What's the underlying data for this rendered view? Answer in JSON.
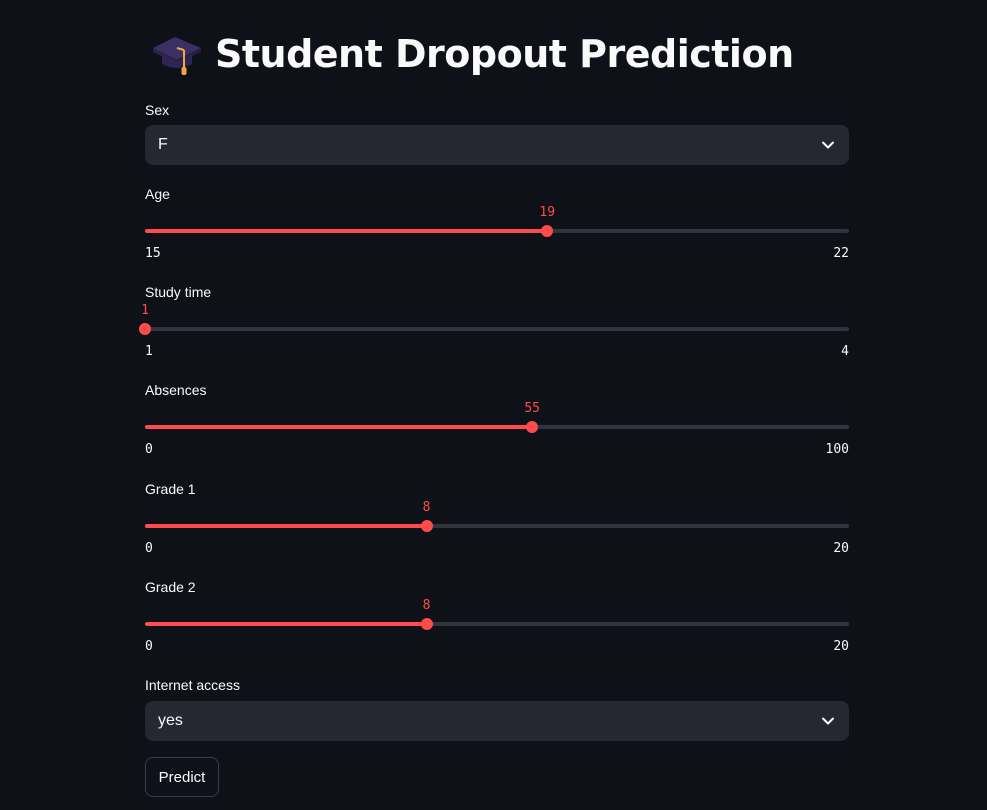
{
  "title": "Student Dropout Prediction",
  "title_icon": "graduation-cap-icon",
  "fields": {
    "sex": {
      "label": "Sex",
      "value": "F"
    },
    "age": {
      "label": "Age",
      "value": "19",
      "min": "15",
      "max": "22",
      "fraction": 0.5714
    },
    "study_time": {
      "label": "Study time",
      "value": "1",
      "min": "1",
      "max": "4",
      "fraction": 0.0
    },
    "absences": {
      "label": "Absences",
      "value": "55",
      "min": "0",
      "max": "100",
      "fraction": 0.55
    },
    "grade1": {
      "label": "Grade 1",
      "value": "8",
      "min": "0",
      "max": "20",
      "fraction": 0.4
    },
    "grade2": {
      "label": "Grade 2",
      "value": "8",
      "min": "0",
      "max": "20",
      "fraction": 0.4
    },
    "internet": {
      "label": "Internet access",
      "value": "yes"
    }
  },
  "predict_label": "Predict",
  "colors": {
    "background": "#0e1117",
    "accent": "#ff4b4b",
    "track": "#31333f",
    "select_bg": "#262730",
    "text": "#fafafa"
  }
}
